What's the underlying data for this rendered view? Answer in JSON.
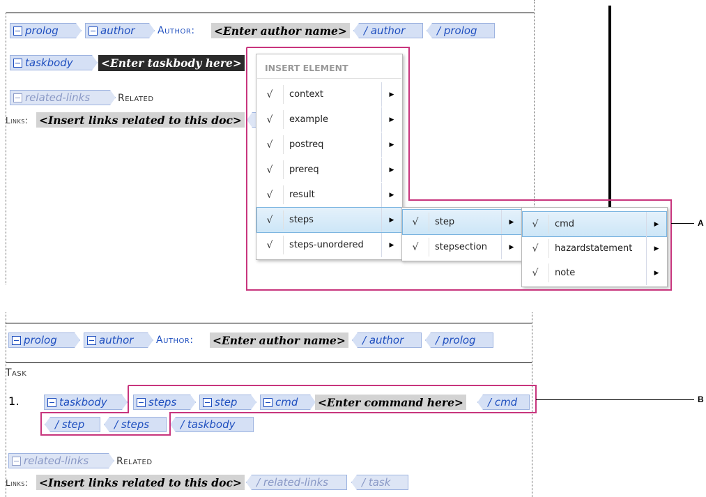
{
  "top": {
    "prolog_open": "prolog",
    "author_open": "author",
    "author_label": "Author:",
    "author_placeholder": "<Enter author name>",
    "author_close": "/ author",
    "prolog_close": "/ prolog",
    "taskbody_open": "taskbody",
    "taskbody_placeholder": "<Enter taskbody here>",
    "related_links_open": "related-links",
    "related_label_1": "Related",
    "related_label_2": "Links:",
    "links_placeholder": "<Insert links related to this doc>"
  },
  "menu": {
    "title": "INSERT ELEMENT",
    "items": [
      {
        "label": "context"
      },
      {
        "label": "example"
      },
      {
        "label": "postreq"
      },
      {
        "label": "prereq"
      },
      {
        "label": "result"
      },
      {
        "label": "steps"
      },
      {
        "label": "steps-unordered"
      }
    ]
  },
  "submenu1": {
    "items": [
      {
        "label": "step"
      },
      {
        "label": "stepsection"
      }
    ]
  },
  "submenu2": {
    "items": [
      {
        "label": "cmd"
      },
      {
        "label": "hazardstatement"
      },
      {
        "label": "note"
      }
    ]
  },
  "glyphs": {
    "check": "√",
    "arrow": "▶"
  },
  "callouts": {
    "a": "A",
    "b": "B"
  },
  "bottom": {
    "prolog_open": "prolog",
    "author_open": "author",
    "author_label": "Author:",
    "author_placeholder": "<Enter author name>",
    "author_close": "/ author",
    "prolog_close": "/ prolog",
    "task_label": "Task",
    "list_number": "1.",
    "taskbody_open": "taskbody",
    "steps_open": "steps",
    "step_open": "step",
    "cmd_open": "cmd",
    "cmd_placeholder": "<Enter command here>",
    "cmd_close": "/ cmd",
    "step_close": "/ step",
    "steps_close": "/ steps",
    "taskbody_close": "/ taskbody",
    "related_links_open": "related-links",
    "related_label_1": "Related",
    "related_label_2": "Links:",
    "links_placeholder": "<Insert links related to this doc>",
    "related_links_close": "/ related-links",
    "task_close": "/ task"
  }
}
